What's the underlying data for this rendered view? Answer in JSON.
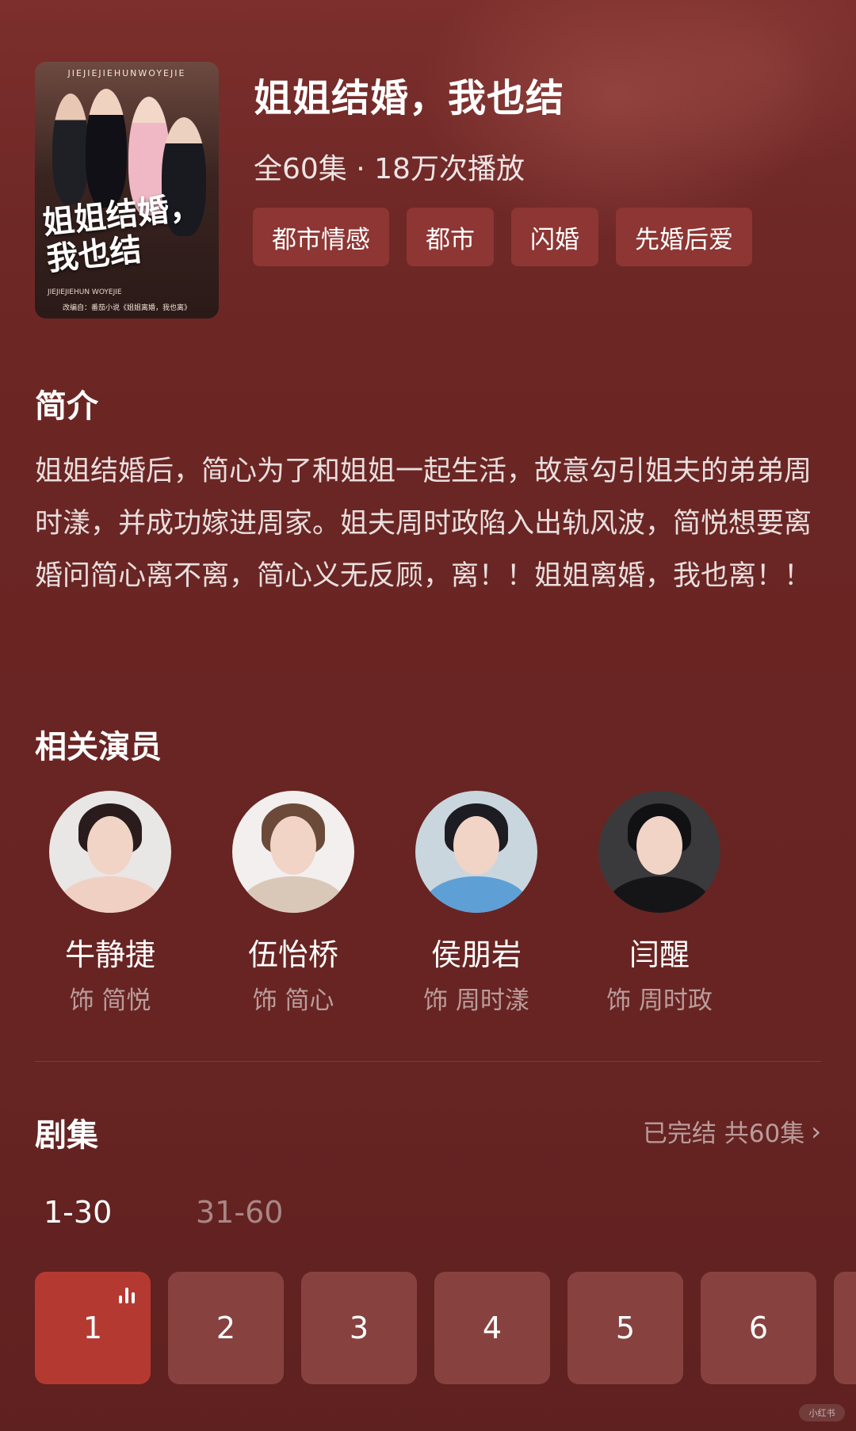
{
  "drama": {
    "title": "姐姐结婚，我也结",
    "meta": "全60集 · 18万次播放",
    "tags": [
      "都市情感",
      "都市",
      "闪婚",
      "先婚后爱"
    ],
    "poster": {
      "caption": "JIEJIEJIEHUNWOYEJIE",
      "art_title": "姐姐结婚，我也结",
      "art_sub": "JIEJIEJIEHUN WOYEJIE",
      "footer": "改编自：番茄小说《姐姐离婚，我也离》"
    }
  },
  "synopsis": {
    "heading": "简介",
    "text": "姐姐结婚后，简心为了和姐姐一起生活，故意勾引姐夫的弟弟周时漾，并成功嫁进周家。姐夫周时政陷入出轨风波，简悦想要离婚问简心离不离，简心义无反顾，离！！姐姐离婚，我也离！！"
  },
  "cast": {
    "heading": "相关演员",
    "actors": [
      {
        "name": "牛静捷",
        "role": "饰 简悦"
      },
      {
        "name": "伍怡桥",
        "role": "饰 简心"
      },
      {
        "name": "侯朋岩",
        "role": "饰 周时漾"
      },
      {
        "name": "闫醒",
        "role": "饰 周时政"
      }
    ]
  },
  "episodes": {
    "heading": "剧集",
    "status": "已完结 共60集",
    "ranges": [
      "1-30",
      "31-60"
    ],
    "items": [
      "1",
      "2",
      "3",
      "4",
      "5",
      "6"
    ],
    "active": "1"
  },
  "watermark": "小红书",
  "colors": {
    "background": "#6b2624",
    "tag_bg": "#8d3633",
    "episode_bg": "#87423f",
    "episode_active_bg": "#b43a31"
  },
  "icons": {
    "chevron": "chevron-right-icon",
    "playing": "playing-bars-icon"
  }
}
